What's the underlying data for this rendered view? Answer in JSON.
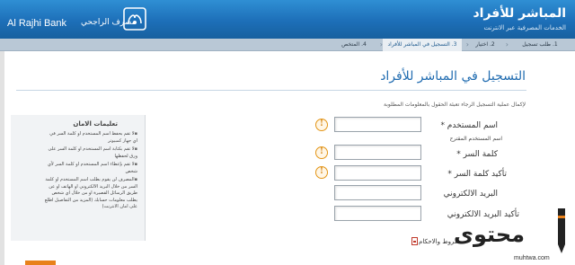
{
  "header": {
    "brand_en": "Al Rajhi Bank",
    "brand_ar": "مصرف الراجحي",
    "title": "المباشر للأفراد",
    "subtitle": "الخدمات المصرفية عبر الانترنت",
    "bg_color": "#1d6fb8"
  },
  "steps": [
    {
      "label": "1. طلب تسجيل",
      "active": false
    },
    {
      "label": "2. اختيار",
      "active": false
    },
    {
      "label": "3. التسجيل في المباشر للأفراد",
      "active": true
    },
    {
      "label": "4. المتخص",
      "active": false
    }
  ],
  "main": {
    "title": "التسجيل في المباشر للأفراد",
    "intro": "لإكمال عملية التسجيل الرجاء تعبئة الحقول بالمعلومات المطلوبة"
  },
  "tips": {
    "title": "تعليمات الامان",
    "items": [
      "لا تقم بحفظ اسم المستخدم او كلمة السر في اي جهاز كمبيوتر",
      "لا تقم بكتابة اسم المستخدم او كلمة السر على ورق لحفظها",
      "لا تقم بإعطاء اسم المستخدم او كلمة السر لأي شخص",
      "المصرف لن يقوم بطلب اسم المستخدم او كلمة السر من خلال البريد الالكتروني او الهاتف او عن طريق الرسائل القصيرة او من خلال اي شخص يطلب معلومات حسابك (المزيد من التفاصيل اطلع على امان الانترنت)"
    ]
  },
  "form": {
    "username_label": "اسم المستخدم *",
    "username_hint": "اسم المستخدم المقترح",
    "password_label": "كلمة السر *",
    "confirm_password_label": "تأكيد كلمة السر *",
    "email_label": "البريد الالكتروني",
    "confirm_email_label": "تأكيد البريد الالكتروني",
    "terms_label": "شروط والاحكام",
    "username_value": "",
    "password_value": "",
    "confirm_password_value": "",
    "email_value": "",
    "confirm_email_value": ""
  },
  "icons": {
    "info": "info-icon",
    "pdf": "pdf-icon"
  },
  "watermark": {
    "text": "محتوى",
    "url": "muhtwa.com"
  }
}
